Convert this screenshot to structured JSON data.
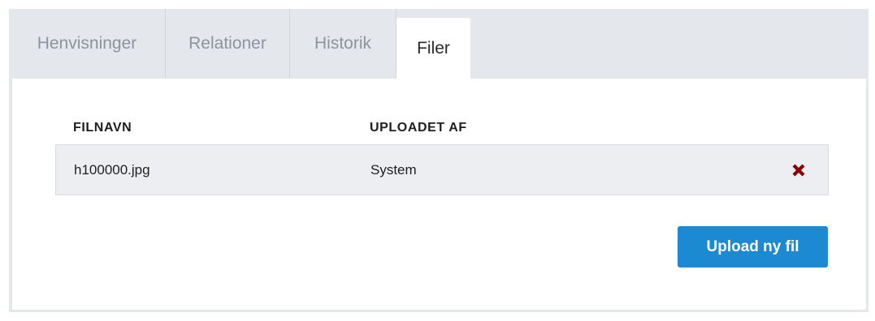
{
  "tabs": [
    {
      "label": "Henvisninger",
      "active": false
    },
    {
      "label": "Relationer",
      "active": false
    },
    {
      "label": "Historik",
      "active": false
    },
    {
      "label": "Filer",
      "active": true
    }
  ],
  "files_table": {
    "columns": [
      "FILNAVN",
      "UPLOADET AF"
    ],
    "rows": [
      {
        "filename": "h100000.jpg",
        "uploaded_by": "System",
        "delete_icon": "delete-x-icon"
      }
    ]
  },
  "upload_button_label": "Upload ny fil",
  "colors": {
    "accent": "#1b8ad2",
    "delete": "#8b0000",
    "panel_bg": "#e4e7ec",
    "row_bg": "#eceef1"
  }
}
